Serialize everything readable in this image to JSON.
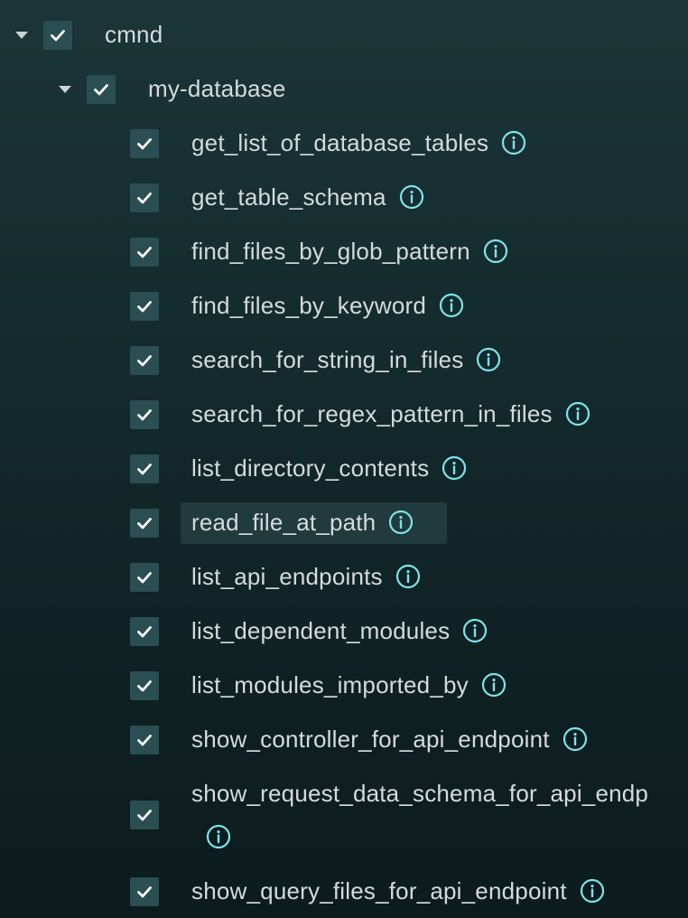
{
  "tree": {
    "root": {
      "label": "cmnd",
      "checked": true,
      "expanded": true
    },
    "group": {
      "label": "my-database",
      "checked": true,
      "expanded": true
    },
    "items": [
      {
        "label": "get_list_of_database_tables",
        "checked": true
      },
      {
        "label": "get_table_schema",
        "checked": true
      },
      {
        "label": "find_files_by_glob_pattern",
        "checked": true
      },
      {
        "label": "find_files_by_keyword",
        "checked": true
      },
      {
        "label": "search_for_string_in_files",
        "checked": true
      },
      {
        "label": "search_for_regex_pattern_in_files",
        "checked": true
      },
      {
        "label": "list_directory_contents",
        "checked": true
      },
      {
        "label": "read_file_at_path",
        "checked": true,
        "highlighted": true
      },
      {
        "label": "list_api_endpoints",
        "checked": true
      },
      {
        "label": "list_dependent_modules",
        "checked": true
      },
      {
        "label": "list_modules_imported_by",
        "checked": true
      },
      {
        "label": "show_controller_for_api_endpoint",
        "checked": true
      },
      {
        "label": "show_request_data_schema_for_api_endp",
        "checked": true
      },
      {
        "label": "show_query_files_for_api_endpoint",
        "checked": true
      }
    ]
  },
  "icons": {
    "caret": "caret-down-icon",
    "checkbox": "checkmark-icon",
    "info": "info-icon"
  },
  "colors": {
    "checkbox_bg": "#2a4e52",
    "info_accent": "#7fe3ea",
    "text": "#d4dbdd",
    "highlight_bg": "#203a3d"
  }
}
